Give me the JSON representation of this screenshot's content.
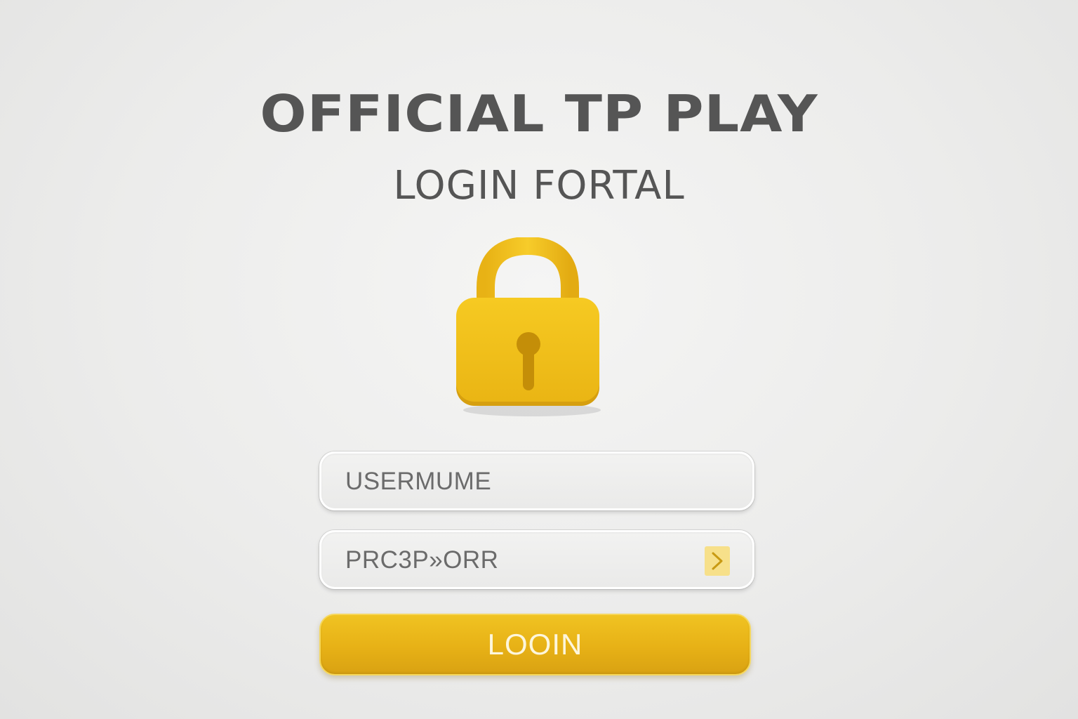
{
  "header": {
    "title": "OFFICIAL TP PLAY",
    "subtitle": "LOGIN FORTAL"
  },
  "lock": {
    "icon": "padlock-icon",
    "color": "#f2c21a"
  },
  "form": {
    "username_value": "USERMUME",
    "password_value": "PRC3P»ORR",
    "submit_icon": "chevron-right-icon",
    "login_label": "LOOIN"
  },
  "colors": {
    "accent": "#e8b417",
    "text": "#555555"
  }
}
